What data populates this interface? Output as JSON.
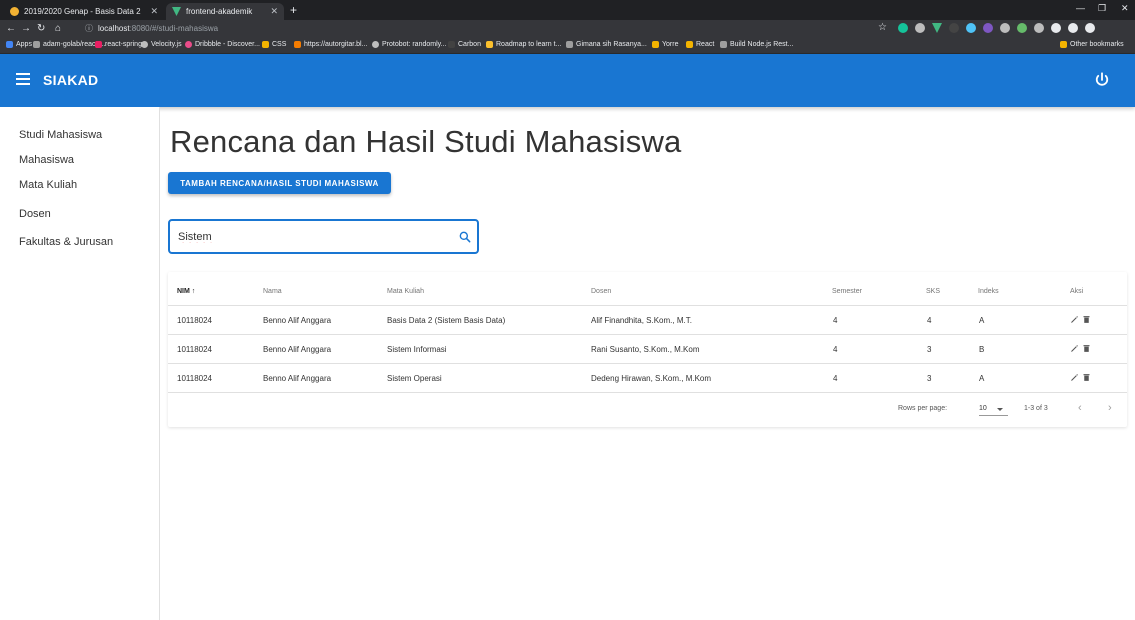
{
  "browser": {
    "tabs": [
      {
        "label": "2019/2020 Genap - Basis Data 2",
        "active": false,
        "favicon_color": "#f2b233"
      },
      {
        "label": "frontend-akademik",
        "active": true,
        "favicon_color": "#41b883"
      }
    ],
    "new_tab": "+",
    "url_host": "localhost",
    "url_rest": ":8080/#/studi-mahasiswa",
    "bookmarks": [
      {
        "label": "Apps",
        "color": "#4285f4"
      },
      {
        "label": "adam-golab/react-...",
        "color": "#9e9e9e"
      },
      {
        "label": "react-spring",
        "color": "#e91e63"
      },
      {
        "label": "Velocity.js",
        "color": "#bdbdbd"
      },
      {
        "label": "Dribbble - Discover...",
        "color": "#ea4c89"
      },
      {
        "label": "CSS",
        "color": "#f4b400"
      },
      {
        "label": "https://autorgitar.bl...",
        "color": "#f57c00"
      },
      {
        "label": "Protobot: randomly...",
        "color": "#bdbdbd"
      },
      {
        "label": "Carbon",
        "color": "#424242"
      },
      {
        "label": "Roadmap to learn t...",
        "color": "#fbc02d"
      },
      {
        "label": "Gimana sih Rasanya...",
        "color": "#9e9e9e"
      },
      {
        "label": "Yorre",
        "color": "#f4b400"
      },
      {
        "label": "React",
        "color": "#f4b400"
      },
      {
        "label": "Build Node.js Rest...",
        "color": "#9e9e9e"
      }
    ],
    "other_bookmarks": "Other bookmarks"
  },
  "appbar": {
    "title": "SIAKAD",
    "color": "#1976d2"
  },
  "sidebar": {
    "items": [
      {
        "label": "Studi Mahasiswa"
      },
      {
        "label": "Mahasiswa"
      },
      {
        "label": "Mata Kuliah"
      },
      {
        "label": "Dosen"
      },
      {
        "label": "Fakultas & Jurusan"
      }
    ]
  },
  "main": {
    "title": "Rencana dan Hasil Studi Mahasiswa",
    "add_button": "TAMBAH RENCANA/HASIL STUDI MAHASISWA",
    "search": {
      "value": "Sistem",
      "placeholder": ""
    }
  },
  "table": {
    "headers": {
      "nim": "NIM",
      "nama": "Nama",
      "mata_kuliah": "Mata Kuliah",
      "dosen": "Dosen",
      "semester": "Semester",
      "sks": "SKS",
      "indeks": "Indeks",
      "aksi": "Aksi"
    },
    "sort_icon": "arrow-up-icon",
    "rows": [
      {
        "nim": "10118024",
        "nama": "Benno Alif Anggara",
        "mata_kuliah": "Basis Data 2 (Sistem Basis Data)",
        "dosen": "Alif Finandhita, S.Kom., M.T.",
        "semester": "4",
        "sks": "4",
        "indeks": "A"
      },
      {
        "nim": "10118024",
        "nama": "Benno Alif Anggara",
        "mata_kuliah": "Sistem Informasi",
        "dosen": "Rani Susanto, S.Kom., M.Kom",
        "semester": "4",
        "sks": "3",
        "indeks": "B"
      },
      {
        "nim": "10118024",
        "nama": "Benno Alif Anggara",
        "mata_kuliah": "Sistem Operasi",
        "dosen": "Dedeng Hirawan, S.Kom., M.Kom",
        "semester": "4",
        "sks": "3",
        "indeks": "A"
      }
    ],
    "footer": {
      "rows_per_page_label": "Rows per page:",
      "rows_per_page_value": "10",
      "range": "1-3 of 3"
    }
  }
}
